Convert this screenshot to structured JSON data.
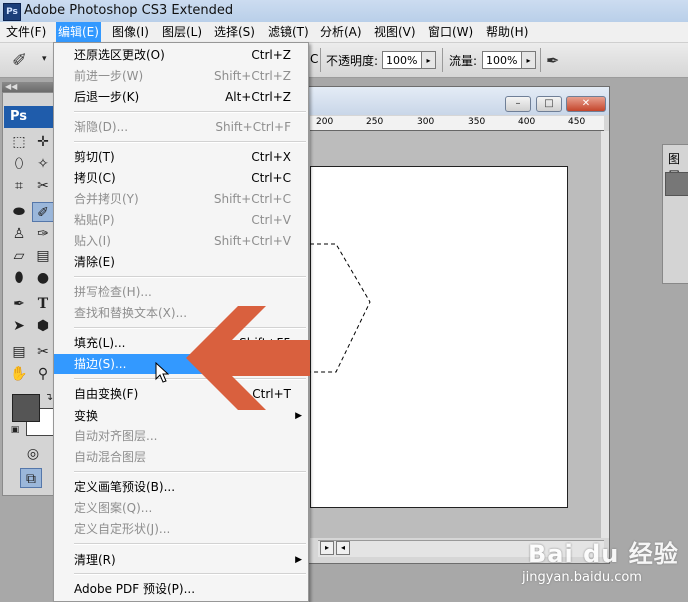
{
  "window": {
    "app_badge": "Ps",
    "title": "Adobe Photoshop CS3 Extended"
  },
  "menubar": {
    "items": [
      {
        "label": "文件(F)"
      },
      {
        "label": "编辑(E)"
      },
      {
        "label": "图像(I)"
      },
      {
        "label": "图层(L)"
      },
      {
        "label": "选择(S)"
      },
      {
        "label": "滤镜(T)"
      },
      {
        "label": "分析(A)"
      },
      {
        "label": "视图(V)"
      },
      {
        "label": "窗口(W)"
      },
      {
        "label": "帮助(H)"
      }
    ],
    "active_index": 1
  },
  "options": {
    "mode_suffix": "C",
    "opacity_label": "不透明度:",
    "opacity_value": "100%",
    "flow_label": "流量:",
    "flow_value": "100%"
  },
  "tools": {
    "badge": "Ps",
    "text_tool_glyph": "T"
  },
  "document": {
    "ruler_labels": [
      "200",
      "250",
      "300",
      "350",
      "400",
      "450"
    ]
  },
  "layers_panel": {
    "tab_label": "图层"
  },
  "edit_menu": {
    "items": [
      {
        "label": "还原选区更改(O)",
        "shortcut": "Ctrl+Z",
        "state": "enabled"
      },
      {
        "label": "前进一步(W)",
        "shortcut": "Shift+Ctrl+Z",
        "state": "disabled"
      },
      {
        "label": "后退一步(K)",
        "shortcut": "Alt+Ctrl+Z",
        "state": "enabled"
      },
      {
        "label": "渐隐(D)...",
        "shortcut": "Shift+Ctrl+F",
        "state": "disabled"
      },
      {
        "label": "剪切(T)",
        "shortcut": "Ctrl+X",
        "state": "enabled"
      },
      {
        "label": "拷贝(C)",
        "shortcut": "Ctrl+C",
        "state": "enabled"
      },
      {
        "label": "合并拷贝(Y)",
        "shortcut": "Shift+Ctrl+C",
        "state": "disabled"
      },
      {
        "label": "粘贴(P)",
        "shortcut": "Ctrl+V",
        "state": "disabled"
      },
      {
        "label": "贴入(I)",
        "shortcut": "Shift+Ctrl+V",
        "state": "disabled"
      },
      {
        "label": "清除(E)",
        "shortcut": "",
        "state": "enabled"
      },
      {
        "label": "拼写检查(H)...",
        "shortcut": "",
        "state": "disabled"
      },
      {
        "label": "查找和替换文本(X)...",
        "shortcut": "",
        "state": "disabled"
      },
      {
        "label": "填充(L)...",
        "shortcut": "Shift+F5",
        "state": "enabled"
      },
      {
        "label": "描边(S)...",
        "shortcut": "",
        "state": "highlighted"
      },
      {
        "label": "自由变换(F)",
        "shortcut": "Ctrl+T",
        "state": "enabled"
      },
      {
        "label": "变换",
        "shortcut": "",
        "state": "enabled",
        "submenu": true
      },
      {
        "label": "自动对齐图层...",
        "shortcut": "",
        "state": "disabled"
      },
      {
        "label": "自动混合图层",
        "shortcut": "",
        "state": "disabled"
      },
      {
        "label": "定义画笔预设(B)...",
        "shortcut": "",
        "state": "enabled"
      },
      {
        "label": "定义图案(Q)...",
        "shortcut": "",
        "state": "disabled"
      },
      {
        "label": "定义自定形状(J)...",
        "shortcut": "",
        "state": "disabled"
      },
      {
        "label": "清理(R)",
        "shortcut": "",
        "state": "enabled",
        "submenu": true
      },
      {
        "label": "Adobe PDF 预设(P)...",
        "shortcut": "",
        "state": "enabled"
      }
    ]
  },
  "watermark": {
    "brand": "Bai du 经验",
    "url": "jingyan.baidu.com"
  },
  "colors": {
    "menu_highlight": "#3399ff",
    "annotation_arrow": "#d9603e",
    "foreground_swatch": "#555555",
    "background_swatch": "#ffffff"
  }
}
